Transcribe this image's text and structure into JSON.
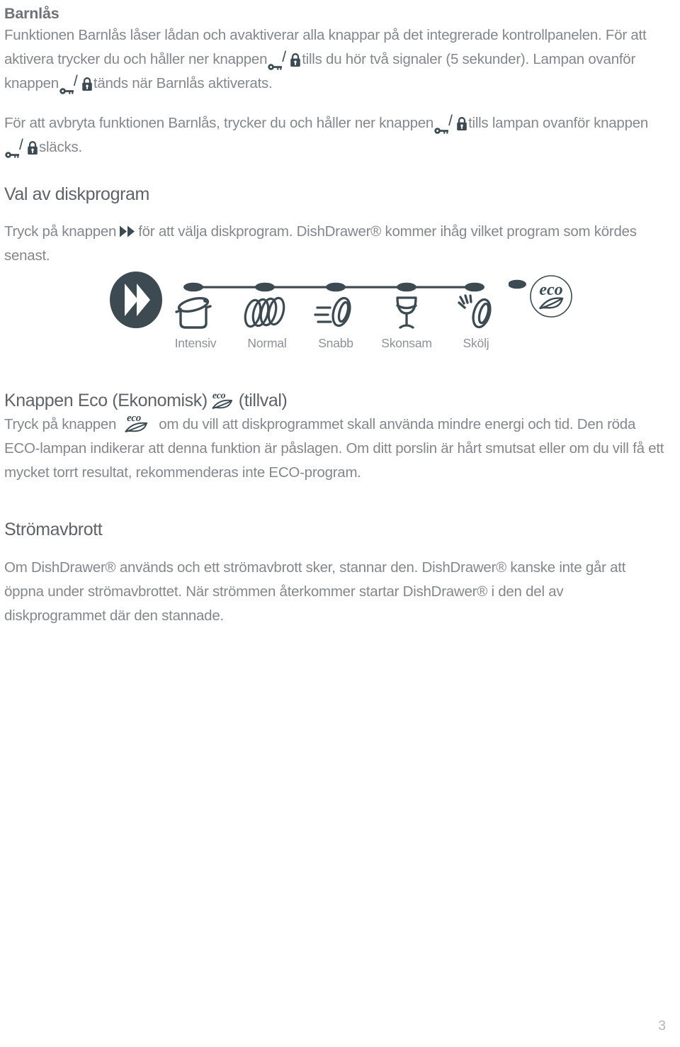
{
  "document": {
    "page_number": "3",
    "colors": {
      "heading_bold": "#6e7277",
      "heading_light": "#5f6367",
      "body_text": "#83878c",
      "icon_dark": "#3d4a51",
      "label_gray": "#8d9196",
      "page_number": "#b2b6ba",
      "background": "#ffffff"
    }
  },
  "sections": {
    "child_lock": {
      "heading": "Barnlås",
      "paragraph1_part1": "Funktionen Barnlås låser lådan och avaktiverar alla knappar på det integrerade kontrollpanelen. För att aktivera trycker du och håller ner knappen",
      "paragraph1_part2": "tills du hör två signaler (5 sekunder). Lampan ovanför knappen",
      "paragraph1_part3": "tänds när Barnlås aktiverats.",
      "paragraph2_part1": "För att avbryta funktionen Barnlås, trycker du och håller ner knappen",
      "paragraph2_part2": "tills lampan ovanför knappen",
      "paragraph2_part3": "släcks.",
      "icon_name": "key-lock-icon"
    },
    "program_selection": {
      "heading": "Val av diskprogram",
      "paragraph_part1": "Tryck på knappen",
      "paragraph_part2": "för att välja diskprogram. DishDrawer® kommer ihåg vilket program som kördes senast.",
      "icon_name": "fast-forward-icon"
    },
    "eco_button": {
      "heading_part1": "Knappen Eco (Ekonomisk)",
      "heading_part2": "(tillval)",
      "paragraph_part1": "Tryck på knappen",
      "paragraph_part2": "om du vill att diskprogrammet skall använda mindre energi och tid. Den röda ECO-lampan indikerar att denna funktion är påslagen. Om ditt porslin är hårt smutsat eller om du vill få ett mycket torrt resultat, rekommenderas inte ECO-program.",
      "icon_name": "eco-leaf-icon"
    },
    "power_failure": {
      "heading": "Strömavbrott",
      "paragraph": "Om DishDrawer® används och ett strömavbrott sker, stannar den. DishDrawer® kanske inte går att öppna under strömavbrottet. När strömmen återkommer startar DishDrawer® i den del av diskprogrammet där den stannade."
    }
  },
  "diagram": {
    "fast_forward_button_name": "fast-forward-button",
    "eco_button_label": "eco",
    "eco_button_name": "eco-button",
    "programs": [
      {
        "label": "Intensiv",
        "icon": "pot-icon"
      },
      {
        "label": "Normal",
        "icon": "stacked-plates-icon"
      },
      {
        "label": "Snabb",
        "icon": "plate-speed-lines-icon"
      },
      {
        "label": "Skonsam",
        "icon": "wine-glass-icon"
      },
      {
        "label": "Skölj",
        "icon": "plate-droplets-icon"
      }
    ]
  }
}
